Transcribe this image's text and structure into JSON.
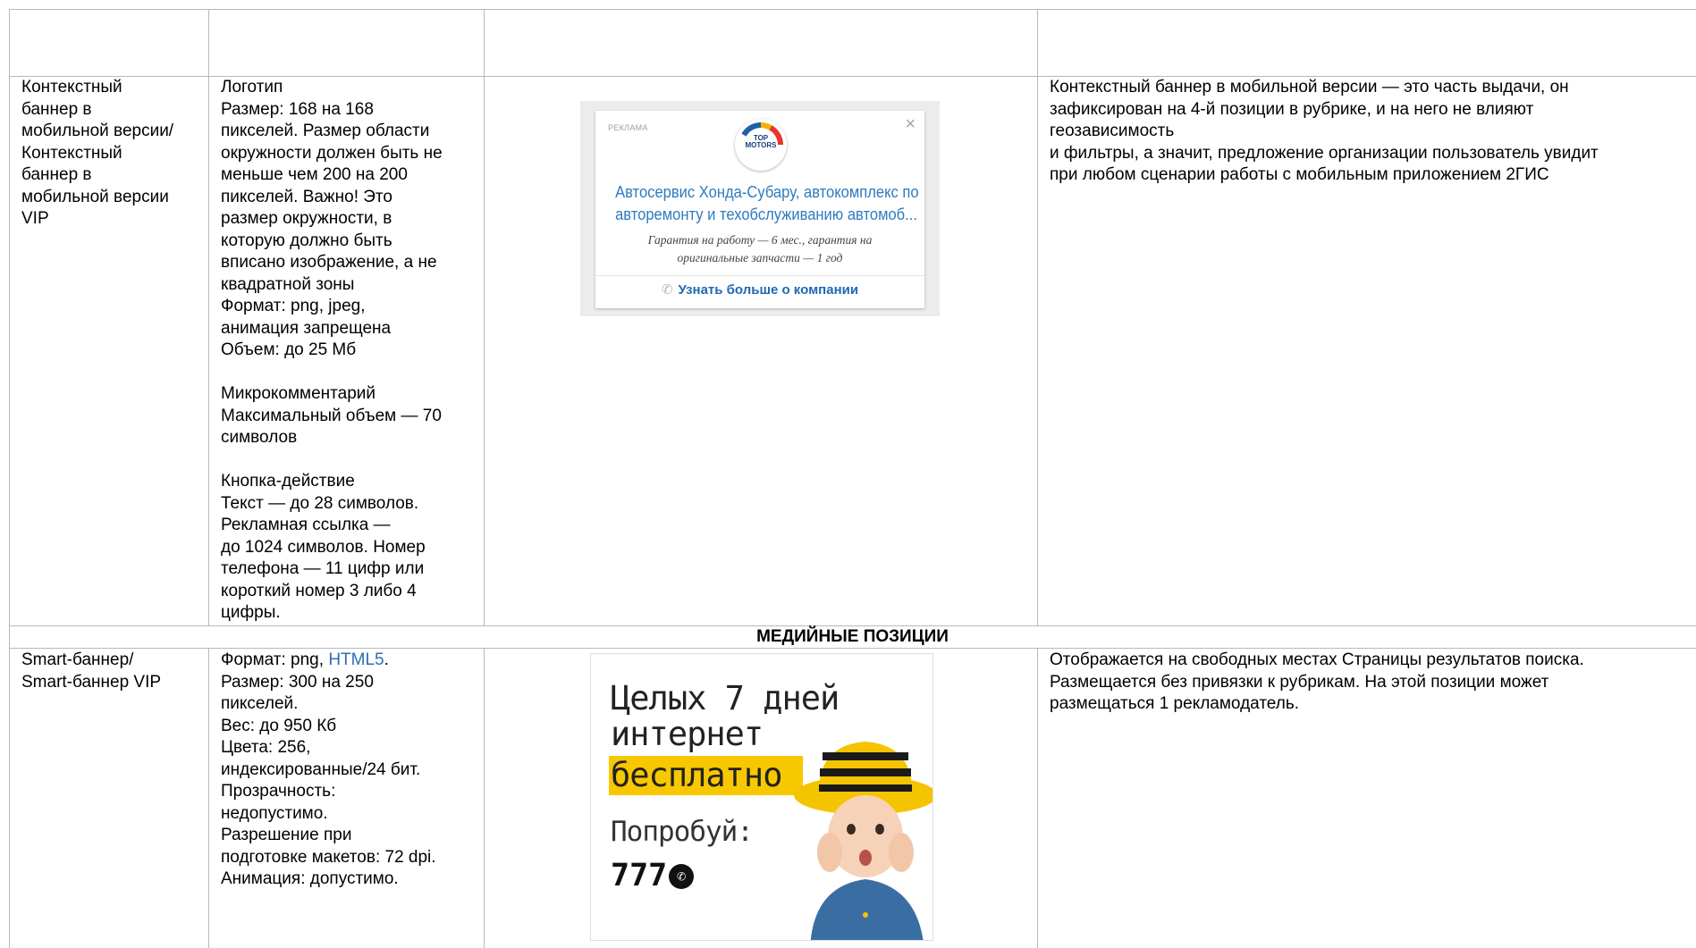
{
  "rows": {
    "context": {
      "name": "Контекстный\nбаннер в\nмобильной версии/\nКонтекстный\nбаннер в\nмобильной версии\nVIP",
      "requirements": "Логотип\nРазмер: 168 на 168\nпикселей. Размер области\nокружности должен быть не\nменьше чем 200 на 200\nпикселей. Важно! Это\nразмер окружности, в\nкоторую должно быть\nвписано изображение, а не\nквадратной зоны\nФормат: png, jpeg,\nанимация запрещена\nОбъем: до 25 Мб\n\nМикрокомментарий\nМаксимальный объем — 70\nсимволов\n\nКнопка-действие\nТекст — до 28 символов.\nРекламная ссылка —\nдо 1024 символов. Номер\nтелефона — 11 цифр или\nкороткий номер 3 либо 4\nцифры.",
      "description": "Контекстный баннер в мобильной версии — это часть выдачи, он\nзафиксирован на 4-й позиции в рубрике, и на него не влияют\nгеозависимость\nи фильтры, а значит, предложение организации пользователь увидит\nпри любом сценарии работы с мобильным приложением 2ГИС",
      "banner": {
        "ad_label": "РЕКЛАМА",
        "close": "×",
        "logo_text": "TOP\nMOTORS",
        "title": "Автосервис Хонда-Субару, автокомплекс по\nавторемонту и техобслуживанию автомоб...",
        "microcomment": "Гарантия на работу — 6 мес., гарантия на\nоригинальные запчасти — 1 год",
        "button_icon": "✆",
        "button_label": "Узнать больше о компании"
      }
    },
    "section_header": "МЕДИЙНЫЕ ПОЗИЦИИ",
    "smart": {
      "name": "Smart-баннер/\nSmart-баннер VIP",
      "format_prefix": "Формат: png, ",
      "format_link": "HTML5",
      "format_suffix": ".",
      "requirements": "Размер: 300 на 250\nпикселей.\nВес: до 950 Кб\nЦвета: 256,\nиндексированные/24 бит.\nПрозрачность:\nнедопустимо.\nРазрешение при\nподготовке макетов: 72 dpi.\nАнимация: допустимо.",
      "description": "Отображается на свободных местах Страницы результатов поиска.\nРазмещается без привязки к рубрикам. На этой позиции может\nразмещаться 1 рекламодатель.",
      "banner": {
        "line1": "Целых 7 дней",
        "line2": "интернет",
        "line3": "бесплатно",
        "line4": "Попробуй:",
        "phone": "777"
      }
    }
  },
  "colors": {
    "grid": "#b9b9b9",
    "link": "#2f6db5",
    "banner_title": "#2d7bc0",
    "banner_button": "#1f68b3",
    "smart_yellow": "#f7c800"
  }
}
